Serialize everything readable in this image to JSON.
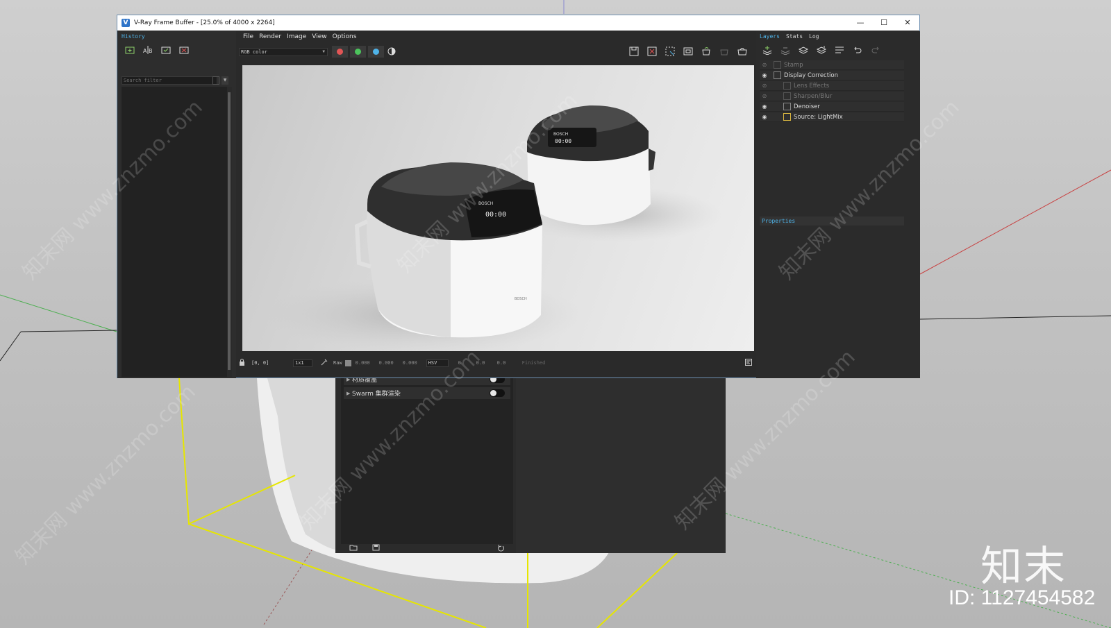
{
  "window": {
    "title": "V-Ray Frame Buffer - [25.0% of 4000 x 2264]",
    "app_icon": "vray-icon",
    "controls": {
      "minimize": "—",
      "maximize": "☐",
      "close": "✕"
    }
  },
  "history": {
    "tab_label": "History",
    "search_placeholder": "Search filter",
    "toolbar_icons": [
      "save-to-history-icon",
      "ab-compare-icon",
      "load-history-icon",
      "clear-history-icon"
    ]
  },
  "menu": {
    "items": [
      "File",
      "Render",
      "Image",
      "View",
      "Options"
    ]
  },
  "toolbar": {
    "channel": "RGB color",
    "channel_colors": [
      "#e25555",
      "#4cc45c",
      "#4fb3e8"
    ],
    "right_icons": [
      "save-image-icon",
      "clear-image-icon",
      "region-render-icon",
      "lens-icon",
      "render-interactive-icon",
      "stop-render-icon",
      "render-icon"
    ]
  },
  "status": {
    "coords": "[0, 0]",
    "zoom": "1x1",
    "mode": "Raw",
    "rgb": [
      "0.000",
      "0.000",
      "0.000"
    ],
    "color_space": "HSV",
    "hsv": [
      "0",
      "0.0",
      "0.0"
    ],
    "state": "Finished"
  },
  "layers": {
    "tabs": [
      "Layers",
      "Stats",
      "Log"
    ],
    "toolbar_icons": [
      "add-layer-icon",
      "remove-layer-icon",
      "save-layers-icon",
      "load-layers-icon",
      "list-icon",
      "undo-icon",
      "redo-icon"
    ],
    "items": [
      {
        "label": "Stamp",
        "visible": false,
        "enabled": false
      },
      {
        "label": "Display Correction",
        "visible": true,
        "enabled": true
      },
      {
        "label": "Lens Effects",
        "visible": false,
        "enabled": false
      },
      {
        "label": "Sharpen/Blur",
        "visible": false,
        "enabled": false
      },
      {
        "label": "Denoiser",
        "visible": true,
        "enabled": true
      },
      {
        "label": "Source: LightMix",
        "visible": true,
        "enabled": true
      }
    ],
    "properties_label": "Properties"
  },
  "settings": {
    "rows": [
      {
        "label": "材质覆盖"
      },
      {
        "label": "Swarm 集群渲染"
      }
    ]
  },
  "branding": {
    "mark": "知末",
    "id": "ID: 1127454582",
    "watermark": "知末网 www.znzmo.com"
  }
}
